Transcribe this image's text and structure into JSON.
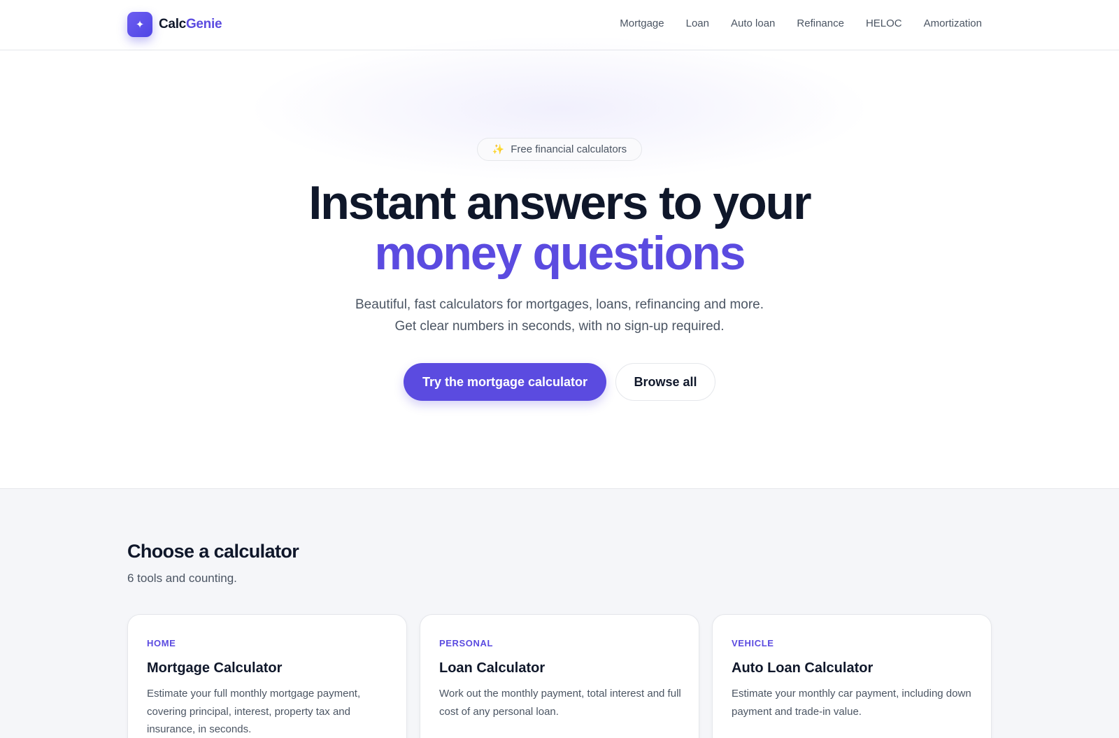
{
  "brand": {
    "name_part1": "Calc",
    "name_part2": "Genie",
    "logo_glyph": "✦"
  },
  "nav": {
    "items": [
      "Mortgage",
      "Loan",
      "Auto loan",
      "Refinance",
      "HELOC",
      "Amortization"
    ]
  },
  "hero": {
    "badge_icon": "✨",
    "badge": "Free financial calculators",
    "title_line1": "Instant answers to your",
    "title_line2": "money questions",
    "subtitle_line1": "Beautiful, fast calculators for mortgages, loans, refinancing and more.",
    "subtitle_line2": "Get clear numbers in seconds, with no sign-up required.",
    "primary_cta": "Try the mortgage calculator",
    "secondary_cta": "Browse all"
  },
  "calculators": {
    "heading": "Choose a calculator",
    "subheading": "6 tools and counting.",
    "cards": [
      {
        "category": "HOME",
        "title": "Mortgage Calculator",
        "description": "Estimate your full monthly mortgage payment, covering principal, interest, property tax and insurance, in seconds."
      },
      {
        "category": "PERSONAL",
        "title": "Loan Calculator",
        "description": "Work out the monthly payment, total interest and full cost of any personal loan."
      },
      {
        "category": "VEHICLE",
        "title": "Auto Loan Calculator",
        "description": "Estimate your monthly car payment, including down payment and trade-in value."
      }
    ]
  },
  "colors": {
    "accent": "#5b4be0",
    "text": "#0f172a",
    "muted": "#4b5563",
    "section_bg": "#f5f6f9"
  }
}
